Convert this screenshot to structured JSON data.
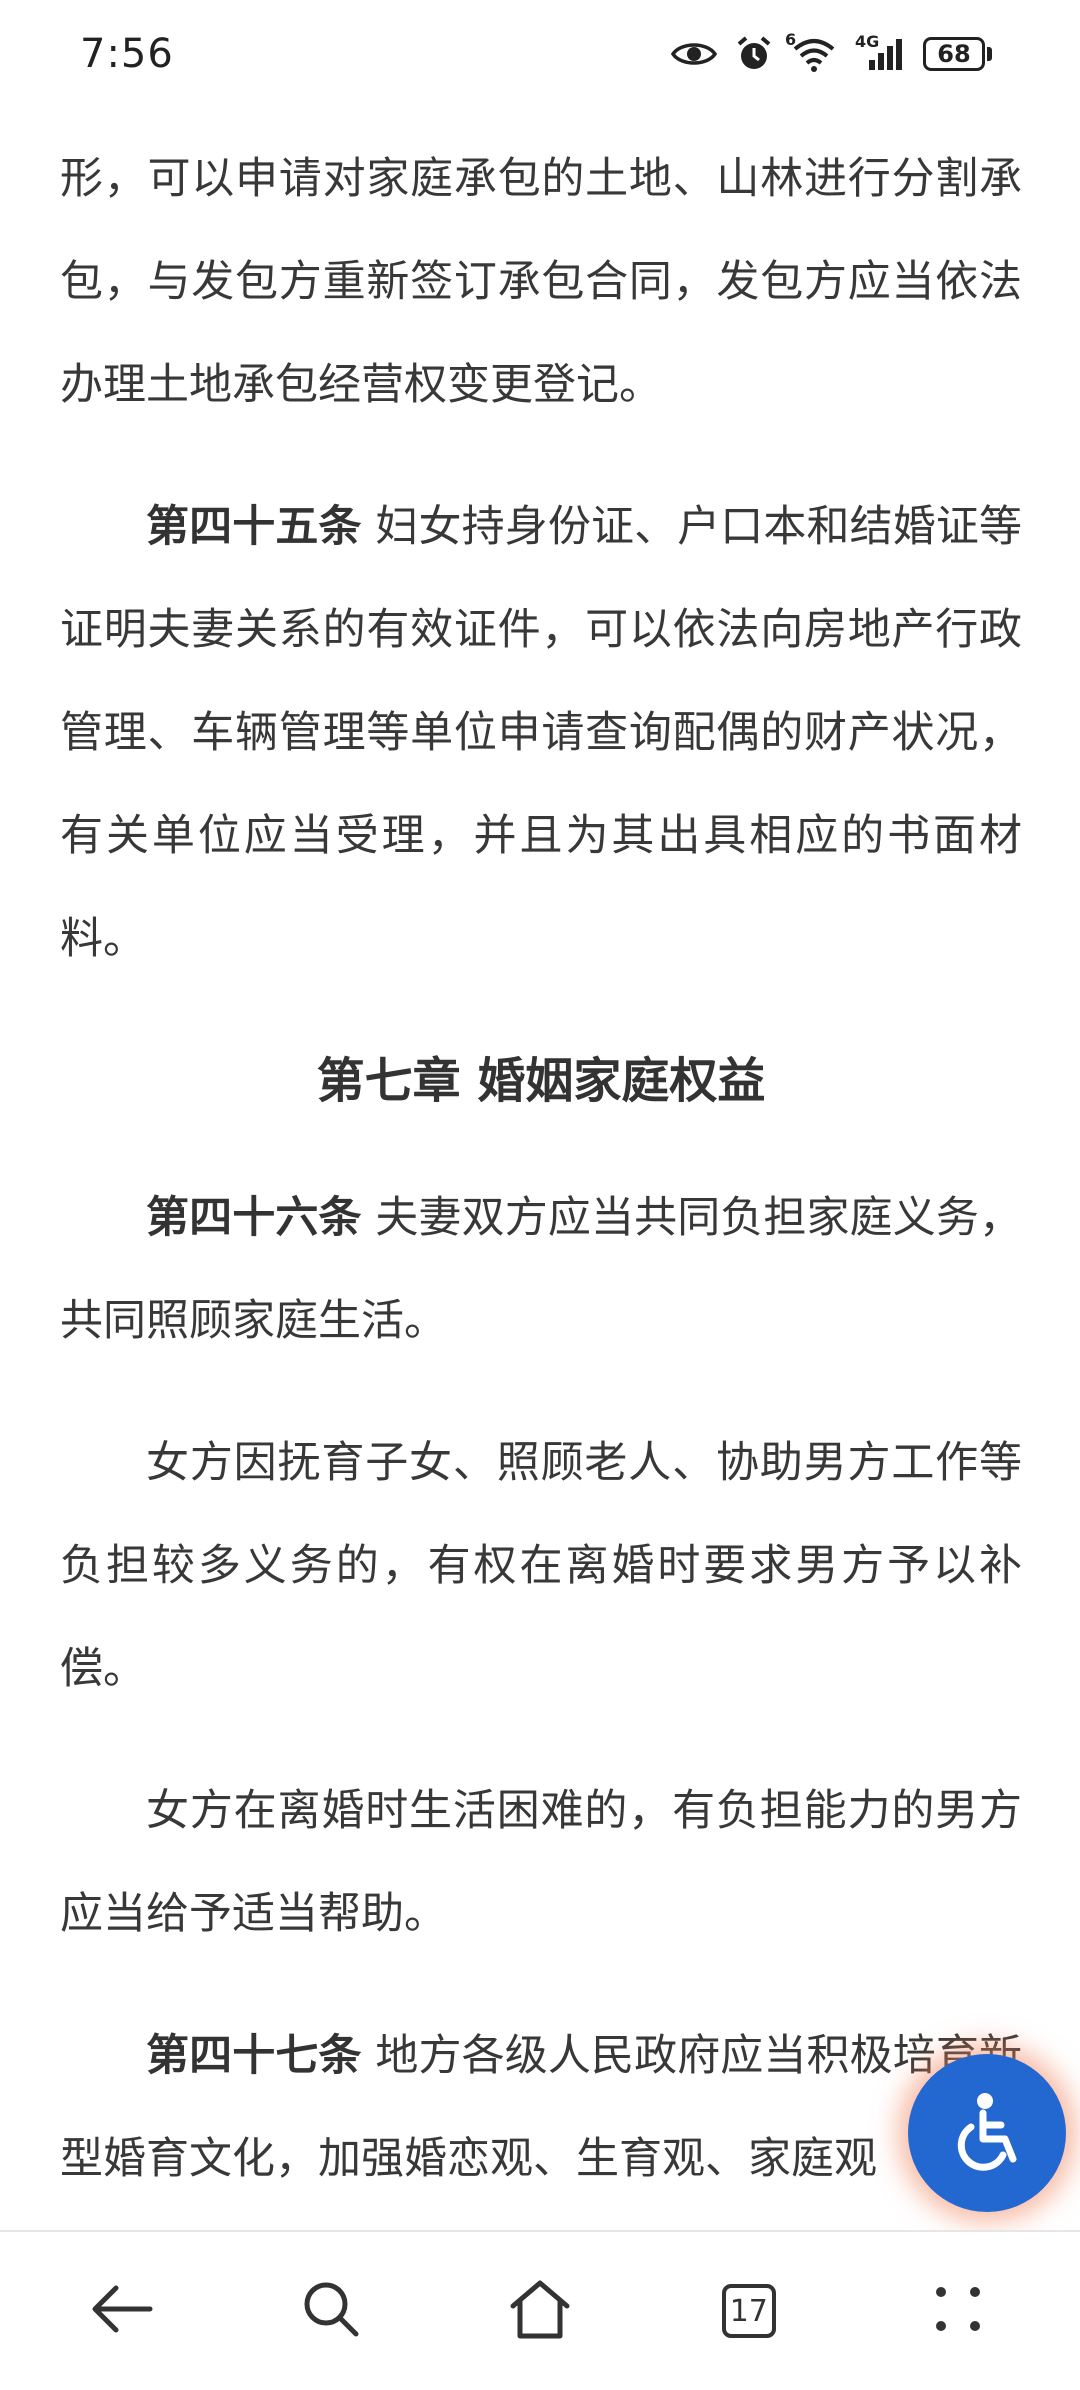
{
  "status_bar": {
    "time": "7:56",
    "signal_label": "4G",
    "wifi_label": "6",
    "battery": "68",
    "icons": [
      "eye-icon",
      "alarm-icon",
      "wifi-icon",
      "cellular-signal-icon",
      "battery-icon"
    ]
  },
  "content": {
    "p1": "形，可以申请对家庭承包的土地、山林进行分割承包，与发包方重新签订承包合同，发包方应当依法办理土地承包经营权变更登记。",
    "p2_article": "第四十五条",
    "p2_text": " 妇女持身份证、户口本和结婚证等证明夫妻关系的有效证件，可以依法向房地产行政管理、车辆管理等单位申请查询配偶的财产状况，有关单位应当受理，并且为其出具相应的书面材料。",
    "chapter_title": "第七章 婚姻家庭权益",
    "p3_article": "第四十六条",
    "p3_text": " 夫妻双方应当共同负担家庭义务，共同照顾家庭生活。",
    "p4": "女方因抚育子女、照顾老人、协助男方工作等负担较多义务的，有权在离婚时要求男方予以补偿。",
    "p5": "女方在离婚时生活困难的，有负担能力的男方应当给予适当帮助。",
    "p6_article": "第四十七条",
    "p6_text": " 地方各级人民政府应当积极培育新型婚育文化，加强婚恋观、生育观、家庭观"
  },
  "accessibility": {
    "icon": "accessibility-icon",
    "color": "#2368d1"
  },
  "bottom_nav": {
    "tabs_count": "17",
    "icons": [
      "back-arrow-icon",
      "search-icon",
      "home-icon",
      "tabs-icon",
      "more-icon"
    ]
  }
}
